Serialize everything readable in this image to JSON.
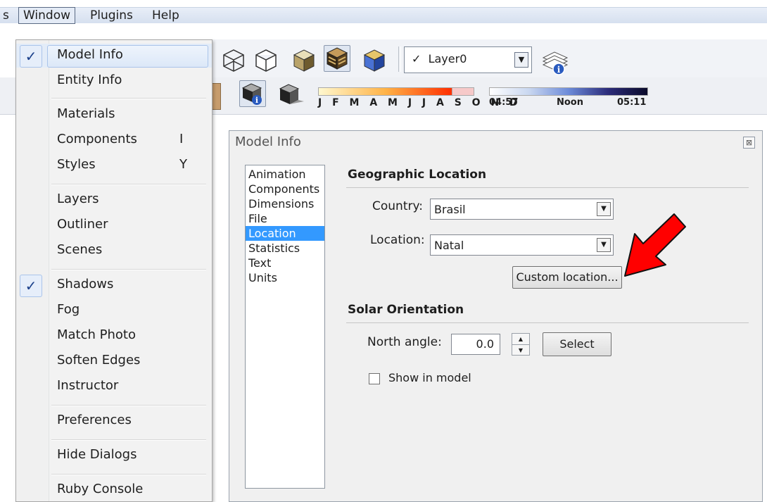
{
  "menubar": {
    "partial_left": "s",
    "window": "Window",
    "plugins": "Plugins",
    "help": "Help"
  },
  "window_menu": {
    "checkmark": "✓",
    "items": [
      {
        "label": "Model Info",
        "checked": true,
        "highlighted": true
      },
      {
        "label": "Entity Info"
      },
      {
        "label": "Materials"
      },
      {
        "label": "Components",
        "shortcut": "I"
      },
      {
        "label": "Styles",
        "shortcut": "Y"
      },
      {
        "label": "Layers"
      },
      {
        "label": "Outliner"
      },
      {
        "label": "Scenes"
      },
      {
        "label": "Shadows",
        "checked": true
      },
      {
        "label": "Fog"
      },
      {
        "label": "Match Photo"
      },
      {
        "label": "Soften Edges"
      },
      {
        "label": "Instructor"
      },
      {
        "label": "Preferences"
      },
      {
        "label": "Hide Dialogs"
      },
      {
        "label": "Ruby Console"
      }
    ]
  },
  "toolbar": {
    "layer_check": "✓",
    "layer_name": "Layer0",
    "months": "J F M A M J J A S O N D",
    "time_start": "04:57",
    "time_mid": "Noon",
    "time_end": "05:11"
  },
  "dialog": {
    "title": "Model Info",
    "close": "⊠",
    "nav": [
      "Animation",
      "Components",
      "Dimensions",
      "File",
      "Location",
      "Statistics",
      "Text",
      "Units"
    ],
    "selected_nav": "Location",
    "geo_title": "Geographic Location",
    "country_label": "Country:",
    "country_value": "Brasil",
    "location_label": "Location:",
    "location_value": "Natal",
    "custom_location": "Custom location...",
    "solar_title": "Solar Orientation",
    "north_label": "North angle:",
    "north_value": "0.0",
    "select_button": "Select",
    "show_in_model": "Show in model"
  },
  "colors": {
    "arrow": "#ff0000",
    "nav_selected": "#3399ff"
  }
}
